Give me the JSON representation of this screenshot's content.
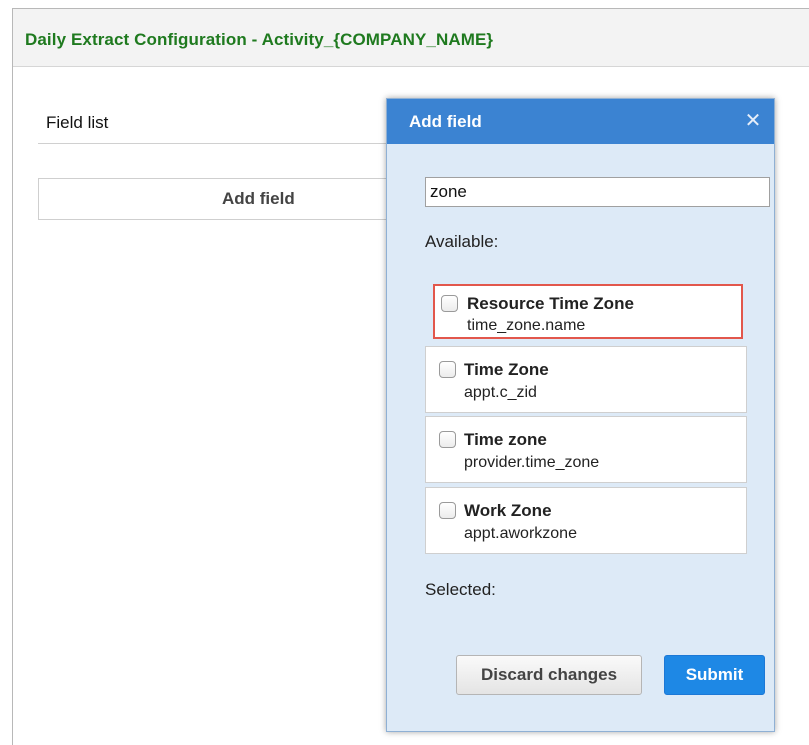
{
  "page": {
    "title": "Daily Extract Configuration - Activity_{COMPANY_NAME}",
    "field_list_label": "Field list",
    "add_field_button": "Add field"
  },
  "dialog": {
    "title": "Add field",
    "close_icon": "close-icon",
    "search_value": "zone",
    "available_label": "Available:",
    "selected_label": "Selected:",
    "available": [
      {
        "name": "Resource Time Zone",
        "key": "time_zone.name",
        "checked": false,
        "highlighted": true
      },
      {
        "name": "Time Zone",
        "key": "appt.c_zid",
        "checked": false,
        "highlighted": false
      },
      {
        "name": "Time zone",
        "key": "provider.time_zone",
        "checked": false,
        "highlighted": false
      },
      {
        "name": "Work Zone",
        "key": "appt.aworkzone",
        "checked": false,
        "highlighted": false
      }
    ],
    "discard_button": "Discard changes",
    "submit_button": "Submit"
  },
  "colors": {
    "title_green": "#1f7a1f",
    "dialog_header": "#3b83d2",
    "dialog_body": "#ddeaf7",
    "submit_blue": "#1e88e5",
    "highlight_red": "#e2574c"
  }
}
